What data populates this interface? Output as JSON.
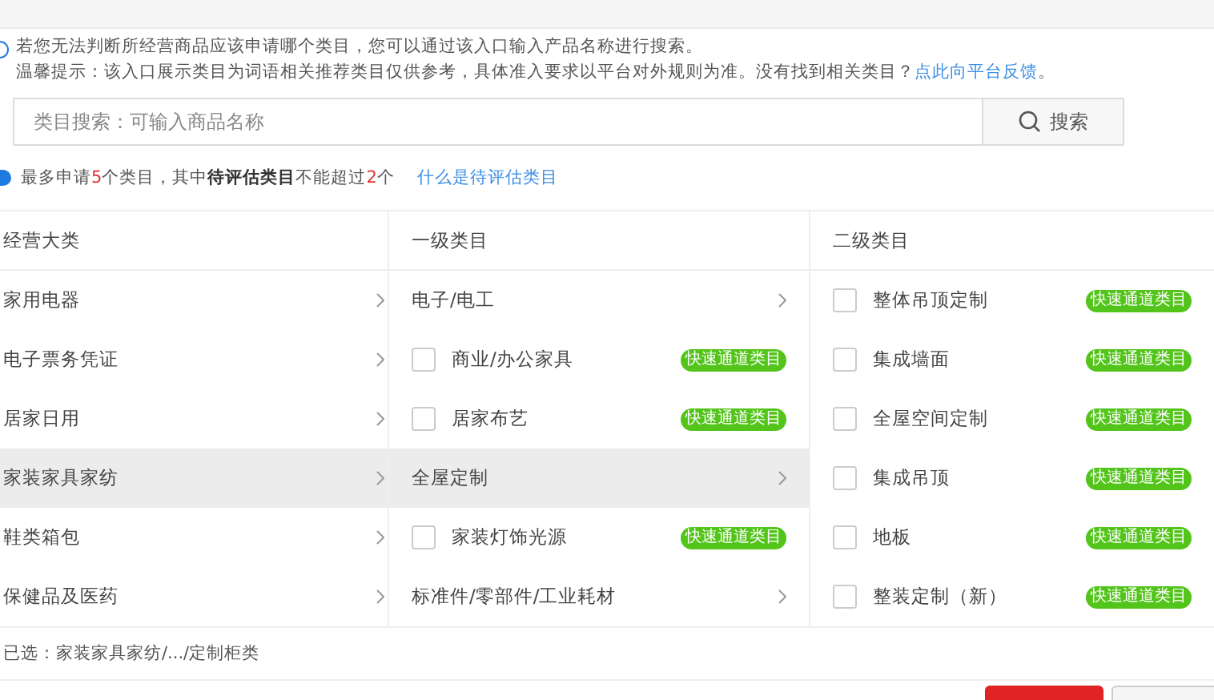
{
  "notice": {
    "line_1": "若您无法判断所经营商品应该申请哪个类目，您可以通过该入口输入产品名称进行搜索。",
    "line_2": "温馨提示：该入口展示类目为词语相关推荐类目仅供参考，具体准入要求以平台对外规则为准。没有找到相关类目？",
    "link": "点此向平台反馈",
    "link_tail": "。"
  },
  "search": {
    "placeholder": "类目搜索：可输入商品名称",
    "button": "搜索"
  },
  "limit_note": {
    "parts": [
      {
        "kind": "plain",
        "text": "最多申请"
      },
      {
        "kind": "count",
        "text": "5"
      },
      {
        "kind": "plain",
        "text": "个类目，其中"
      },
      {
        "kind": "strong",
        "text": "待评估类目"
      },
      {
        "kind": "plain",
        "text": "不能超过"
      },
      {
        "kind": "count",
        "text": "2"
      },
      {
        "kind": "plain",
        "text": "个"
      }
    ],
    "link": "什么是待评估类目"
  },
  "columns": [
    {
      "title": "经营大类",
      "items": [
        {
          "kind": "branch",
          "label": "家用电器",
          "selected": false
        },
        {
          "kind": "branch",
          "label": "电子票务凭证",
          "selected": false
        },
        {
          "kind": "branch",
          "label": "居家日用",
          "selected": false
        },
        {
          "kind": "branch",
          "label": "家装家具家纺",
          "selected": true
        },
        {
          "kind": "branch",
          "label": "鞋类箱包",
          "selected": false
        },
        {
          "kind": "branch",
          "label": "保健品及医药",
          "selected": false
        }
      ]
    },
    {
      "title": "一级类目",
      "items": [
        {
          "kind": "branch",
          "label": "电子/电工",
          "selected": false
        },
        {
          "kind": "leaf",
          "label": "商业/办公家具",
          "checked": false,
          "badge": "快速通道类目"
        },
        {
          "kind": "leaf",
          "label": "居家布艺",
          "checked": false,
          "badge": "快速通道类目"
        },
        {
          "kind": "branch",
          "label": "全屋定制",
          "selected": true
        },
        {
          "kind": "leaf",
          "label": "家装灯饰光源",
          "checked": false,
          "badge": "快速通道类目"
        },
        {
          "kind": "branch",
          "label": "标准件/零部件/工业耗材",
          "selected": false
        }
      ]
    },
    {
      "title": "二级类目",
      "items": [
        {
          "kind": "leaf",
          "label": "整体吊顶定制",
          "checked": false,
          "badge": "快速通道类目"
        },
        {
          "kind": "leaf",
          "label": "集成墙面",
          "checked": false,
          "badge": "快速通道类目"
        },
        {
          "kind": "leaf",
          "label": "全屋空间定制",
          "checked": false,
          "badge": "快速通道类目"
        },
        {
          "kind": "leaf",
          "label": "集成吊顶",
          "checked": false,
          "badge": "快速通道类目"
        },
        {
          "kind": "leaf",
          "label": "地板",
          "checked": false,
          "badge": "快速通道类目"
        },
        {
          "kind": "leaf",
          "label": "整装定制（新）",
          "checked": false,
          "badge": "快速通道类目"
        }
      ]
    }
  ],
  "selected_path": "已选：家装家具家纺/.../定制柜类",
  "buttons": [
    {
      "kind": "primary"
    },
    {
      "kind": "secondary"
    }
  ]
}
